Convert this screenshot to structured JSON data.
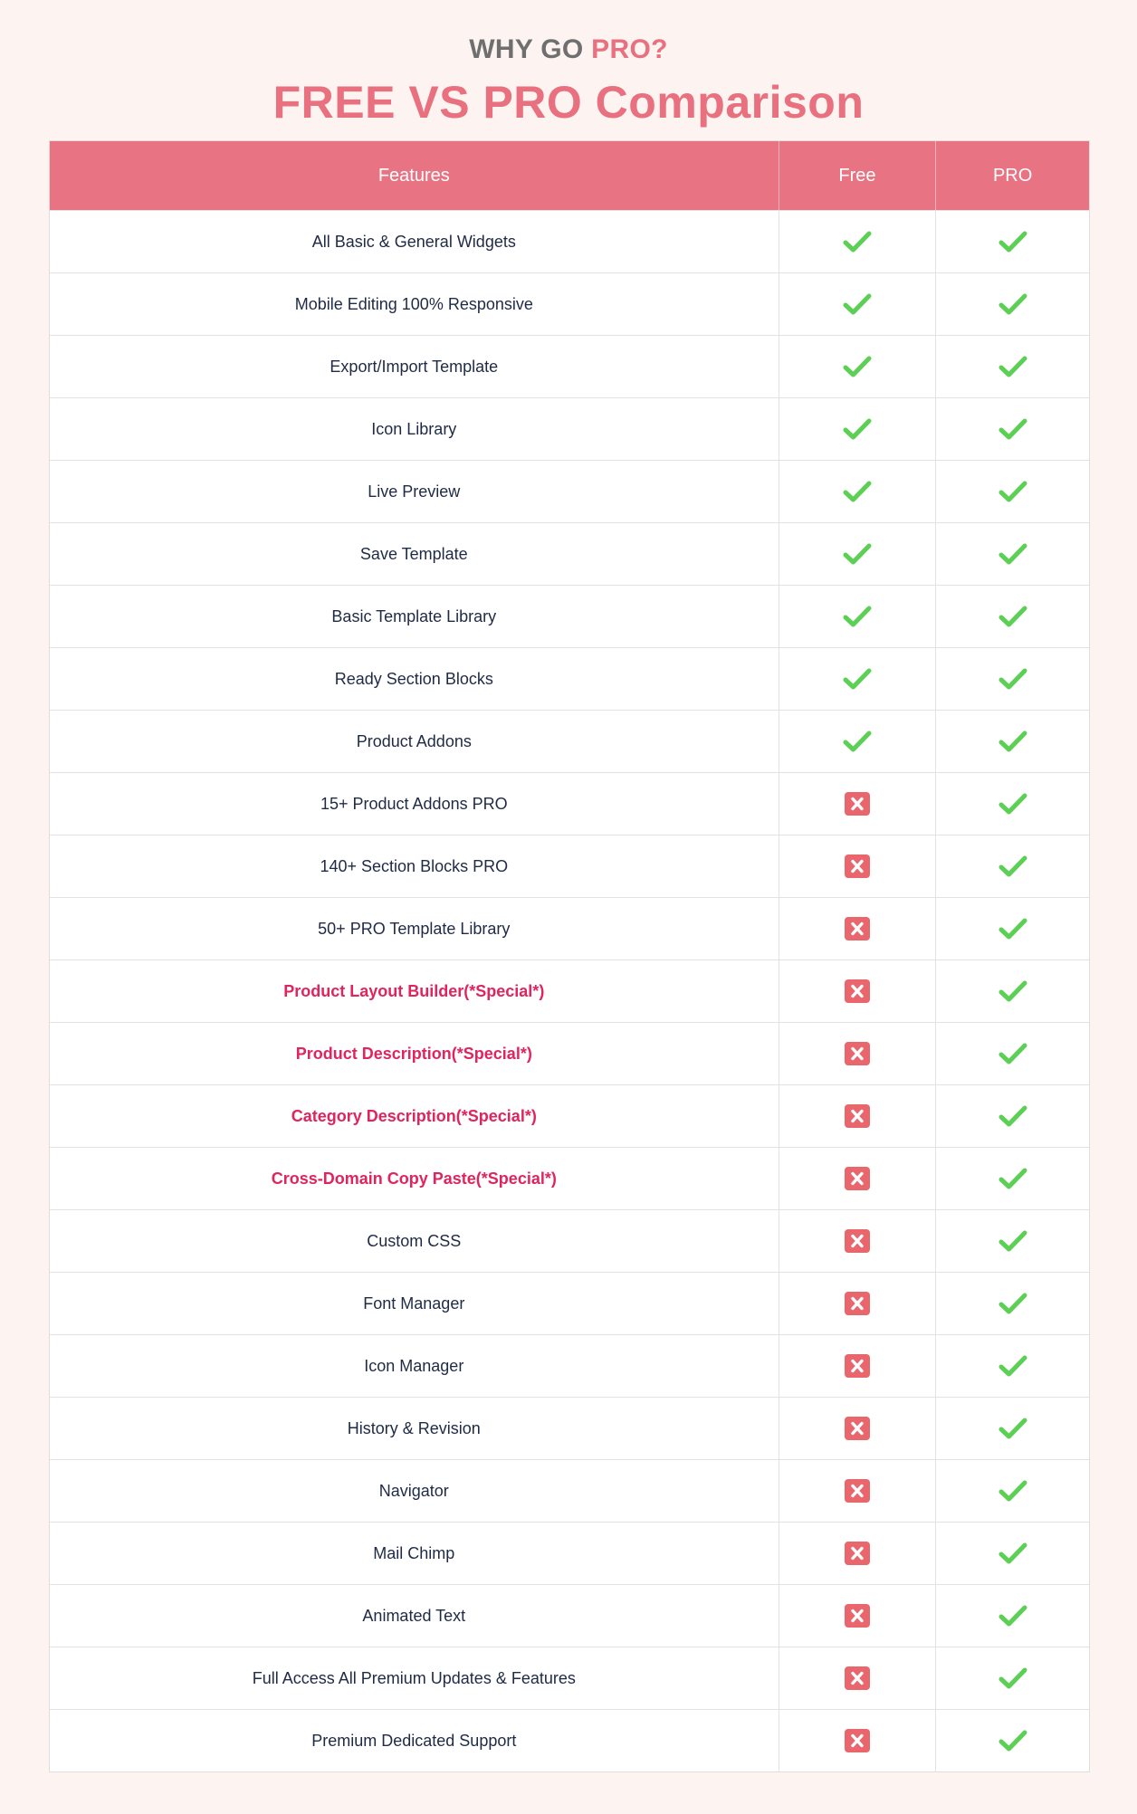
{
  "header": {
    "eyebrow_prefix": "WHY GO ",
    "eyebrow_accent": "PRO?",
    "title": "FREE VS PRO Comparison"
  },
  "colors": {
    "accent": "#e8707f",
    "check": "#5ccf55",
    "cross": "#e9666d",
    "special_text": "#e0245e"
  },
  "table": {
    "columns": [
      "Features",
      "Free",
      "PRO"
    ],
    "rows": [
      {
        "feature": "All Basic & General Widgets",
        "free": true,
        "pro": true,
        "special": false
      },
      {
        "feature": "Mobile Editing 100% Responsive",
        "free": true,
        "pro": true,
        "special": false
      },
      {
        "feature": "Export/Import Template",
        "free": true,
        "pro": true,
        "special": false
      },
      {
        "feature": "Icon Library",
        "free": true,
        "pro": true,
        "special": false
      },
      {
        "feature": "Live Preview",
        "free": true,
        "pro": true,
        "special": false
      },
      {
        "feature": "Save Template",
        "free": true,
        "pro": true,
        "special": false
      },
      {
        "feature": "Basic Template Library",
        "free": true,
        "pro": true,
        "special": false
      },
      {
        "feature": "Ready Section Blocks",
        "free": true,
        "pro": true,
        "special": false
      },
      {
        "feature": "Product Addons",
        "free": true,
        "pro": true,
        "special": false
      },
      {
        "feature": "15+ Product Addons PRO",
        "free": false,
        "pro": true,
        "special": false
      },
      {
        "feature": "140+ Section Blocks PRO",
        "free": false,
        "pro": true,
        "special": false
      },
      {
        "feature": "50+ PRO Template Library",
        "free": false,
        "pro": true,
        "special": false
      },
      {
        "feature": "Product Layout Builder(*Special*)",
        "free": false,
        "pro": true,
        "special": true
      },
      {
        "feature": "Product Description(*Special*)",
        "free": false,
        "pro": true,
        "special": true
      },
      {
        "feature": "Category Description(*Special*)",
        "free": false,
        "pro": true,
        "special": true
      },
      {
        "feature": "Cross-Domain Copy Paste(*Special*)",
        "free": false,
        "pro": true,
        "special": true
      },
      {
        "feature": "Custom CSS",
        "free": false,
        "pro": true,
        "special": false
      },
      {
        "feature": "Font Manager",
        "free": false,
        "pro": true,
        "special": false
      },
      {
        "feature": "Icon Manager",
        "free": false,
        "pro": true,
        "special": false
      },
      {
        "feature": "History & Revision",
        "free": false,
        "pro": true,
        "special": false
      },
      {
        "feature": "Navigator",
        "free": false,
        "pro": true,
        "special": false
      },
      {
        "feature": "Mail Chimp",
        "free": false,
        "pro": true,
        "special": false
      },
      {
        "feature": "Animated Text",
        "free": false,
        "pro": true,
        "special": false
      },
      {
        "feature": "Full Access All Premium Updates & Features",
        "free": false,
        "pro": true,
        "special": false
      },
      {
        "feature": "Premium Dedicated Support",
        "free": false,
        "pro": true,
        "special": false
      }
    ]
  }
}
